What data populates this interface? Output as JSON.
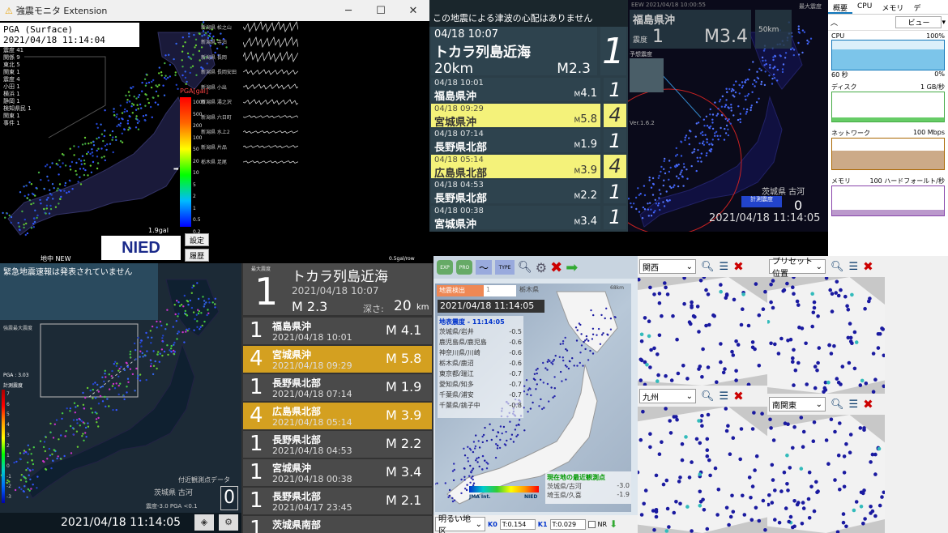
{
  "colors": {
    "accent_yellow": "#f4f27a",
    "panel_teal": "#2e434e",
    "gold": "#d4a020",
    "nied_blue": "#1a2a8a"
  },
  "kmoni": {
    "window_title": "強震モニタ Extension",
    "pga_title": "PGA (Surface)",
    "pga_time": "2021/04/18 11:14:04",
    "counts": [
      "震度 41",
      "関係 9",
      "東北 5",
      "関東 1",
      "震度 4",
      "小田 1",
      "横浜 1",
      "静岡 1",
      "検知県民 1",
      "関東 1",
      "事件 1"
    ],
    "wave_stations": [
      "新潟県 松之山",
      "新潟県 寺泊",
      "新潟県 長岡",
      "新潟県 長岡安田",
      "新潟県 小出",
      "新潟県 湯之沢",
      "新潟県 六日町",
      "新潟県 水上2",
      "新潟県 片品",
      "栃木県 足尾"
    ],
    "scale_label": "PGA[gal]",
    "scale_ticks": [
      "1000",
      "500",
      "200",
      "100",
      "50",
      "20",
      "10",
      "5",
      "2",
      "1",
      "0.5",
      "0.2",
      "0.1",
      "0.05",
      "0.02",
      "0.01"
    ],
    "max_gal": "1.9gal",
    "footer_left": "地中 NEW",
    "footer_right": "0.5gal/row",
    "logo": "NIED",
    "btn_settings": "設定",
    "btn_history": "履歴"
  },
  "quake_list": {
    "tsunami": "この地震による津波の心配はありません",
    "main": {
      "time": "04/18 10:07",
      "place": "トカラ列島近海",
      "depth": "20km",
      "mag": "2.3",
      "intensity": "1"
    },
    "rows": [
      {
        "time": "04/18 10:01",
        "place": "福島県沖",
        "mag": "4.1",
        "intensity": "1",
        "highlight": false
      },
      {
        "time": "04/18 09:29",
        "place": "宮城県沖",
        "mag": "5.8",
        "intensity": "4",
        "highlight": true
      },
      {
        "time": "04/18 07:14",
        "place": "長野県北部",
        "mag": "1.9",
        "intensity": "1",
        "highlight": false
      },
      {
        "time": "04/18 05:14",
        "place": "広島県北部",
        "mag": "3.9",
        "intensity": "4",
        "highlight": true
      },
      {
        "time": "04/18 04:53",
        "place": "長野県北部",
        "mag": "2.2",
        "intensity": "1",
        "highlight": false
      },
      {
        "time": "04/18 00:38",
        "place": "宮城県沖",
        "mag": "3.4",
        "intensity": "1",
        "highlight": false
      }
    ]
  },
  "eew": {
    "header": "EEW 2021/04/18 10:00:55",
    "hdr_right": "最大震度",
    "place": "福島県沖",
    "intensity_label": "震度",
    "intensity": "1",
    "mag": "3.4",
    "depth": "50km",
    "predicted_label": "予想震度",
    "version": "Ver.1.6.2",
    "station": "茨城県 古河",
    "station_label": "計測震度",
    "station_value": "0",
    "datetime": "2021/04/18 11:14:05"
  },
  "taskmgr": {
    "tabs": [
      "概要",
      "CPU",
      "メモリ",
      "デ"
    ],
    "view_btn": "ビュー",
    "cpu_label": "CPU",
    "cpu_pct": "100%",
    "cpu_axis_l": "60 秒",
    "cpu_axis_r": "0%",
    "disk_label": "ディスク",
    "disk_max": "1 GB/秒",
    "net_label": "ネットワーク",
    "net_max": "100 Mbps",
    "mem_label": "メモリ",
    "mem_max": "100 ハードフォールト/秒"
  },
  "kyoshin": {
    "banner": "緊急地震速報は発表されていません",
    "max_label": "強震最大震度",
    "pga_label": "PGA : 3.03",
    "shindo_label": "計測震度",
    "scale": [
      "7",
      "6",
      "5",
      "4",
      "3",
      "2",
      "1",
      "0",
      "-1",
      "-2",
      "-3"
    ],
    "nearby_label": "付近観測点データ",
    "station": "茨城県 古河",
    "station_detail": "震度-3.0  PGA <0.1",
    "station_value": "0",
    "datetime": "2021/04/18 11:14:05"
  },
  "history": {
    "max_label": "最大震度",
    "main": {
      "intensity": "1",
      "place": "トカラ列島近海",
      "datetime": "2021/04/18  10:07",
      "mag": "2.3",
      "depth_label": "深さ:",
      "depth": "20",
      "depth_unit": "km"
    },
    "rows": [
      {
        "intensity": "1",
        "place": "福島県沖",
        "datetime": "2021/04/18  10:01",
        "mag": "4.1",
        "gold": false
      },
      {
        "intensity": "4",
        "place": "宮城県沖",
        "datetime": "2021/04/18  09:29",
        "mag": "5.8",
        "gold": true
      },
      {
        "intensity": "1",
        "place": "長野県北部",
        "datetime": "2021/04/18  07:14",
        "mag": "1.9",
        "gold": false
      },
      {
        "intensity": "4",
        "place": "広島県北部",
        "datetime": "2021/04/18  05:14",
        "mag": "3.9",
        "gold": true
      },
      {
        "intensity": "1",
        "place": "長野県北部",
        "datetime": "2021/04/18  04:53",
        "mag": "2.2",
        "gold": false
      },
      {
        "intensity": "1",
        "place": "宮城県沖",
        "datetime": "2021/04/18  00:38",
        "mag": "3.4",
        "gold": false
      },
      {
        "intensity": "1",
        "place": "長野県北部",
        "datetime": "2021/04/17  23:45",
        "mag": "2.1",
        "gold": false
      },
      {
        "intensity": "1",
        "place": "茨城県南部",
        "datetime": "",
        "mag": "",
        "gold": false
      }
    ]
  },
  "jma": {
    "toolbar": [
      "EXP",
      "PRO",
      "TYPE"
    ],
    "detect_label": "地震検出",
    "detect_value": "1",
    "detect_place": "栃木県",
    "range": "68km",
    "datetime": "2021/04/18 11:14:05",
    "list_title": "地表震度 - 11:14:05",
    "list": [
      {
        "place": "茨城県/岩井",
        "value": "-0.5"
      },
      {
        "place": "鹿児島県/鹿児島",
        "value": "-0.6"
      },
      {
        "place": "神奈川県/川崎",
        "value": "-0.6"
      },
      {
        "place": "栃木県/鹿沼",
        "value": "-0.6"
      },
      {
        "place": "東京都/瑞江",
        "value": "-0.7"
      },
      {
        "place": "愛知県/知多",
        "value": "-0.7"
      },
      {
        "place": "千葉県/浦安",
        "value": "-0.7"
      },
      {
        "place": "千葉県/銚子中",
        "value": "-0.8"
      }
    ],
    "current_title": "現在地の最近観測点",
    "current": [
      {
        "place": "茨城県/古河",
        "value": "-3.0"
      },
      {
        "place": "埼玉県/久喜",
        "value": "-1.9"
      }
    ],
    "legend_left": "JMA Int.",
    "legend_right": "NIED",
    "area_select": "明るい地区",
    "k0_label": "K0",
    "k0_value": "T:0.154",
    "k1_label": "K1",
    "k1_value": "T:0.029",
    "nr_label": "NR"
  },
  "regions": [
    {
      "name": "関西"
    },
    {
      "name": "プリセット位置"
    },
    {
      "name": "九州"
    },
    {
      "name": "南関東"
    }
  ]
}
